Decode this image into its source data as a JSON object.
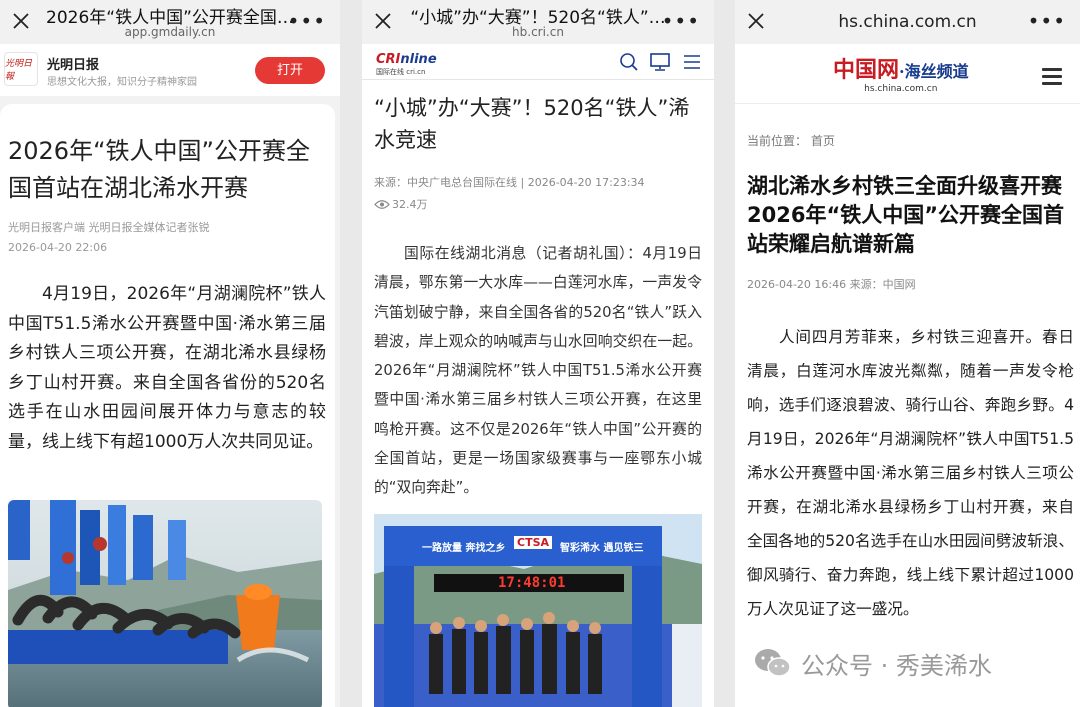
{
  "panel1": {
    "bar": {
      "title": "2026年“铁人中国”公开赛全国…",
      "url": "app.gmdaily.cn",
      "more": "•••"
    },
    "app": {
      "logo_text": "光明日報",
      "name": "光明日报",
      "slogan": "思想文化大报，知识分子精神家园",
      "open_button": "打开"
    },
    "article": {
      "title": "2026年“铁人中国”公开赛全国首站在湖北浠水开赛",
      "source": "光明日报客户端 光明日报全媒体记者张锐",
      "date": "2026-04-20 22:06",
      "body": "4月19日，2026年“月湖澜院杯”铁人中国T51.5浠水公开赛暨中国·浠水第三届乡村铁人三项公开赛，在湖北浠水县绿杨乡丁山村开赛。来自全国各省份的520名选手在山水田园间展开体力与意志的较量，线上线下有超1000万人次共同见证。"
    }
  },
  "panel2": {
    "bar": {
      "title": "“小城”办“大赛”！520名“铁人”…",
      "url": "hb.cri.cn",
      "more": "•••"
    },
    "site": {
      "logo_main": "CRI",
      "logo_sub": "nline",
      "logo_caption": "国际在线 cri.cn"
    },
    "article": {
      "title": "“小城”办“大赛”！520名“铁人”浠水竞速",
      "meta": "来源：中央广电总台国际在线  |  2026-04-20 17:23:34",
      "views": "32.4万",
      "body": "国际在线湖北消息（记者胡礼国）：4月19日清晨，鄂东第一大水库——白莲河水库，一声发令汽笛划破宁静，来自全国各省的520名“铁人”跃入碧波，岸上观众的呐喊声与山水回响交织在一起。2026年“月湖澜院杯”铁人中国T51.5浠水公开赛暨中国·浠水第三届乡村铁人三项公开赛，在这里鸣枪开赛。这不仅是2026年“铁人中国”公开赛的全国首站，更是一场国家级赛事与一座鄂东小城的“双向奔赴”。"
    },
    "photo": {
      "banner_left": "一路放量 奔找之乡",
      "banner_right": "智彩浠水 遇见铁三",
      "banner_logo": "CTSA",
      "timer": "17:48:01"
    }
  },
  "panel3": {
    "bar": {
      "url": "hs.china.com.cn",
      "more": "•••"
    },
    "site": {
      "logo_main": "中国网",
      "logo_channel": "·海丝频道",
      "logo_sub": "hs.china.com.cn"
    },
    "breadcrumb": "当前位置：  首页",
    "article": {
      "title": "湖北浠水乡村铁三全面升级喜开赛 2026年“铁人中国”公开赛全国首站荣耀启航谱新篇",
      "meta": "2026-04-20 16:46    来源：中国网",
      "body": "人间四月芳菲来，乡村铁三迎喜开。春日清晨，白莲河水库波光粼粼，随着一声发令枪响，选手们逐浪碧波、骑行山谷、奔跑乡野。4月19日，2026年“月湖澜院杯”铁人中国T51.5浠水公开赛暨中国·浠水第三届乡村铁人三项公开赛，在湖北浠水县绿杨乡丁山村开赛，来自全国各地的520名选手在山水田园间劈波斩浪、御风骑行、奋力奔跑，线上线下累计超过1000万人次见证了这一盛况。"
    },
    "watermark": "公众号 · 秀美浠水"
  }
}
